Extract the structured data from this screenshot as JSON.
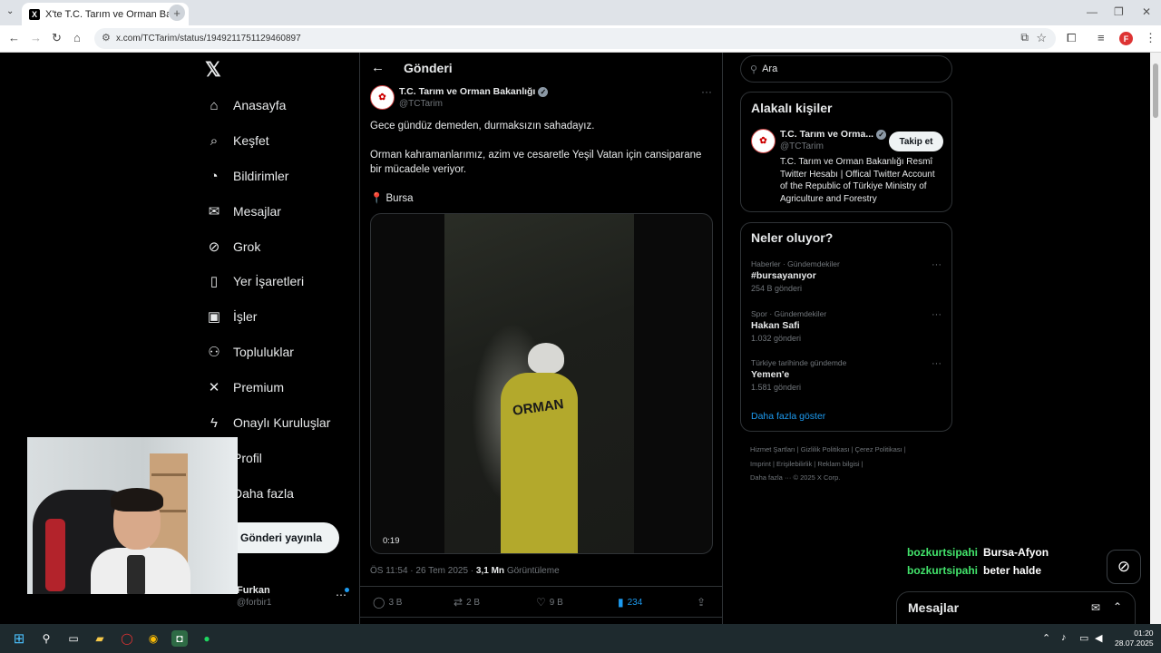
{
  "browser": {
    "tab_title": "X'te T.C. Tarım ve Orman Bakan",
    "url": "x.com/TCTarim/status/1949211751129460897"
  },
  "nav": {
    "items": [
      {
        "label": "Anasayfa",
        "icon": "home-icon",
        "glyph": "⌂"
      },
      {
        "label": "Keşfet",
        "icon": "search-icon",
        "glyph": "⌕"
      },
      {
        "label": "Bildirimler",
        "icon": "bell-icon",
        "glyph": "◔"
      },
      {
        "label": "Mesajlar",
        "icon": "mail-icon",
        "glyph": "✉"
      },
      {
        "label": "Grok",
        "icon": "grok-icon",
        "glyph": "⊘"
      },
      {
        "label": "Yer İşaretleri",
        "icon": "bookmark-icon",
        "glyph": "▯"
      },
      {
        "label": "İşler",
        "icon": "briefcase-icon",
        "glyph": "▣"
      },
      {
        "label": "Topluluklar",
        "icon": "communities-icon",
        "glyph": "⚇"
      },
      {
        "label": "Premium",
        "icon": "x-logo-icon",
        "glyph": "✕"
      },
      {
        "label": "Onaylı Kuruluşlar",
        "icon": "lightning-icon",
        "glyph": "ϟ"
      },
      {
        "label": "Profil",
        "icon": "person-icon",
        "glyph": "◯"
      },
      {
        "label": "Daha fazla",
        "icon": "more-circle-icon",
        "glyph": "⋯"
      }
    ],
    "post_button": "Gönderi yayınla",
    "user_name": "Furkan",
    "user_handle": "@forbir1"
  },
  "main": {
    "header_title": "Gönderi",
    "author_name": "T.C. Tarım ve Orman Bakanlığı",
    "author_handle": "@TCTarim",
    "text1": "Gece gündüz demeden, durmaksızın sahadayız.",
    "text2": "Orman kahramanlarımız, azim ve cesaretle Yeşil Vatan için cansiparane bir mücadele veriyor.",
    "location": "📍 Bursa",
    "video_overlay_text": "ORMAN",
    "video_time": "0:19",
    "timestamp": "ÖS 11:54 · 26 Tem 2025 · ",
    "views_count": "3,1 Mn",
    "views_label": " Görüntüleme",
    "replies": "3 B",
    "reposts": "2 B",
    "likes": "9 B",
    "bookmarks": "234"
  },
  "right": {
    "search_placeholder": "Ara",
    "related_title": "Alakalı kişiler",
    "person_name": "T.C. Tarım ve Orma...",
    "person_handle": "@TCTarim",
    "follow_label": "Takip et",
    "person_bio": "T.C. Tarım ve Orman Bakanlığı Resmî Twitter Hesabı | Offical Twitter Account of the Republic of Türkiye Ministry of Agriculture and Forestry",
    "trends_title": "Neler oluyor?",
    "trends": [
      {
        "category": "Haberler · Gündemdekiler",
        "title": "#bursayanıyor",
        "count": "254 B gönderi"
      },
      {
        "category": "Spor · Gündemdekiler",
        "title": "Hakan Safi",
        "count": "1.032 gönderi"
      },
      {
        "category": "Türkiye tarihinde gündemde",
        "title": "Yemen'e",
        "count": "1.581 gönderi"
      }
    ],
    "show_more": "Daha fazla göster",
    "footer_line1": "Hizmet Şartları  |  Gizlilik Politikası  |  Çerez Politikası  |",
    "footer_line2": "Imprint  |  Erişilebilirlik  |  Reklam bilgisi  |",
    "footer_line3": "Daha fazla ···   © 2025 X Corp."
  },
  "chat": [
    {
      "user": "bozkurtsipahi",
      "msg": "Bursa-Afyon"
    },
    {
      "user": "bozkurtsipahi",
      "msg": "beter halde"
    }
  ],
  "messages_drawer": {
    "title": "Mesajlar"
  },
  "taskbar": {
    "time": "01:20",
    "date": "28.07.2025"
  }
}
